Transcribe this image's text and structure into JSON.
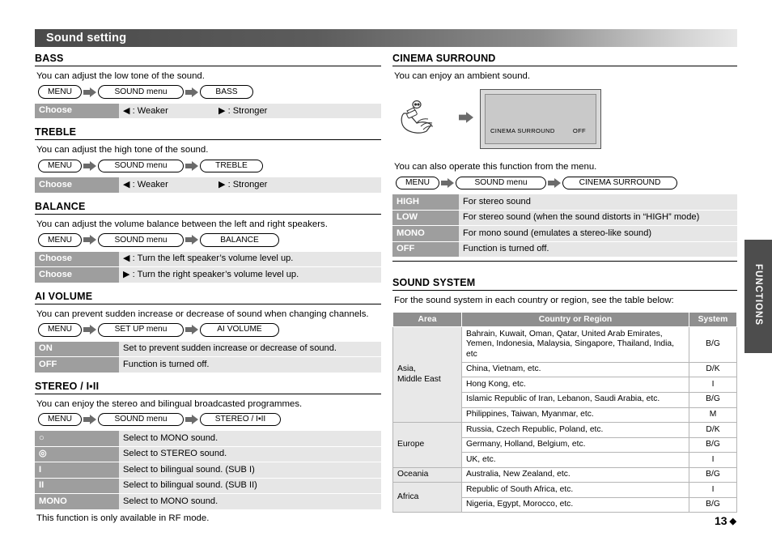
{
  "header": {
    "title": "Sound setting"
  },
  "side_tab": {
    "label": "FUNCTIONS"
  },
  "page_number": {
    "value": "13",
    "mark": "◆"
  },
  "arrows": {
    "right": "▶",
    "left": "◀"
  },
  "left_column": {
    "bass": {
      "heading": "BASS",
      "description": "You can adjust the low tone of the sound.",
      "path": [
        "MENU",
        "SOUND menu",
        "BASS"
      ],
      "rows": [
        {
          "key": "Choose",
          "val_left": "◀ : Weaker",
          "val_right": "▶ : Stronger"
        }
      ]
    },
    "treble": {
      "heading": "TREBLE",
      "description": "You can adjust the high tone of the sound.",
      "path": [
        "MENU",
        "SOUND menu",
        "TREBLE"
      ],
      "rows": [
        {
          "key": "Choose",
          "val_left": "◀ : Weaker",
          "val_right": "▶ : Stronger"
        }
      ]
    },
    "balance": {
      "heading": "BALANCE",
      "description": "You can adjust the volume balance between the left and right speakers.",
      "path": [
        "MENU",
        "SOUND menu",
        "BALANCE"
      ],
      "rows": [
        {
          "key": "Choose",
          "val": "◀ : Turn the left speaker’s volume level up."
        },
        {
          "key": "Choose",
          "val": "▶ : Turn the right speaker’s volume level up."
        }
      ]
    },
    "ai_volume": {
      "heading": "AI VOLUME",
      "description": "You can prevent sudden increase or decrease of sound when changing channels.",
      "path": [
        "MENU",
        "SET UP menu",
        "AI VOLUME"
      ],
      "rows": [
        {
          "key": "ON",
          "val": "Set to prevent sudden increase or decrease of sound."
        },
        {
          "key": "OFF",
          "val": "Function is turned off."
        }
      ]
    },
    "stereo": {
      "heading": "STEREO / I▪II",
      "description": "You can enjoy the stereo and bilingual broadcasted programmes.",
      "path": [
        "MENU",
        "SOUND menu",
        "STEREO / I▪II"
      ],
      "rows": [
        {
          "key": "○",
          "val": "Select to MONO sound."
        },
        {
          "key": "◎",
          "val": "Select to STEREO sound."
        },
        {
          "key": "I",
          "val": "Select to bilingual sound. (SUB I)"
        },
        {
          "key": "II",
          "val": "Select to bilingual sound. (SUB II)"
        },
        {
          "key": "MONO",
          "val": "Select to MONO sound."
        }
      ],
      "note": "This function is only available in RF mode."
    }
  },
  "right_column": {
    "cinema_surround": {
      "heading": "CINEMA SURROUND",
      "description": "You can enjoy an ambient sound.",
      "figure": {
        "screen_label": "CINEMA SURROUND",
        "screen_value": "OFF"
      },
      "description2": "You can also operate this function from the menu.",
      "path": [
        "MENU",
        "SOUND menu",
        "CINEMA SURROUND"
      ],
      "rows": [
        {
          "key": "HIGH",
          "val": "For stereo sound"
        },
        {
          "key": "LOW",
          "val": "For stereo sound (when the sound distorts in “HIGH” mode)"
        },
        {
          "key": "MONO",
          "val": "For mono sound (emulates a stereo-like sound)"
        },
        {
          "key": "OFF",
          "val": "Function is turned off."
        }
      ]
    },
    "sound_system": {
      "heading": "SOUND SYSTEM",
      "description": "For the sound system in each country or region, see the table below:",
      "table": {
        "headers": [
          "Area",
          "Country or Region",
          "System"
        ],
        "groups": [
          {
            "area": "Asia,\nMiddle East",
            "rows": [
              {
                "region": "Bahrain, Kuwait, Oman, Qatar, United Arab Emirates, Yemen, Indonesia, Malaysia, Singapore, Thailand, India, etc",
                "system": "B/G"
              },
              {
                "region": "China, Vietnam, etc.",
                "system": "D/K"
              },
              {
                "region": "Hong Kong, etc.",
                "system": "I"
              },
              {
                "region": "Islamic Republic of Iran, Lebanon, Saudi Arabia, etc.",
                "system": "B/G"
              },
              {
                "region": "Philippines, Taiwan, Myanmar, etc.",
                "system": "M"
              }
            ]
          },
          {
            "area": "Europe",
            "rows": [
              {
                "region": "Russia, Czech Republic, Poland, etc.",
                "system": "D/K"
              },
              {
                "region": "Germany, Holland, Belgium, etc.",
                "system": "B/G"
              },
              {
                "region": "UK, etc.",
                "system": "I"
              }
            ]
          },
          {
            "area": "Oceania",
            "rows": [
              {
                "region": "Australia, New Zealand, etc.",
                "system": "B/G"
              }
            ]
          },
          {
            "area": "Africa",
            "rows": [
              {
                "region": "Republic of South Africa, etc.",
                "system": "I"
              },
              {
                "region": "Nigeria, Egypt, Morocco, etc.",
                "system": "B/G"
              }
            ]
          }
        ]
      }
    }
  }
}
